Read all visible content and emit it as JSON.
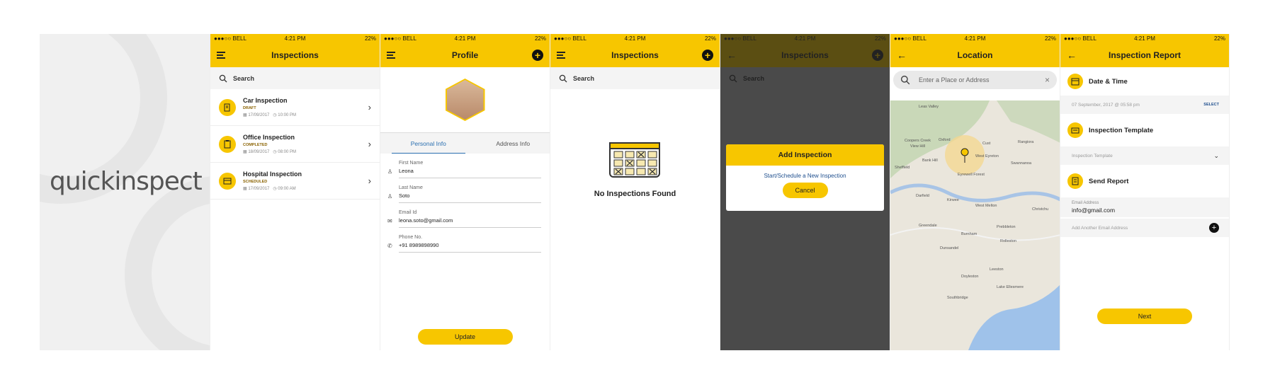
{
  "brand": {
    "logo_text_a": "quick",
    "logo_text_b": "inspect"
  },
  "status": {
    "carrier": "●●●○○ BELL",
    "time": "4:21 PM",
    "battery": "22%"
  },
  "screen1": {
    "title": "Inspections",
    "search_label": "Search",
    "items": [
      {
        "title": "Car Inspection",
        "status": "DRAFT",
        "date": "17/09/2017",
        "time": "10:00 PM"
      },
      {
        "title": "Office Inspection",
        "status": "COMPLETED",
        "date": "18/09/2017",
        "time": "08:00 PM"
      },
      {
        "title": "Hospital Inspection",
        "status": "SCHEDULED",
        "date": "17/09/2017",
        "time": "09:00 AM"
      }
    ]
  },
  "screen2": {
    "title": "Profile",
    "tabs": [
      "Personal Info",
      "Address Info"
    ],
    "fields": [
      {
        "label": "First Name",
        "value": "Leona"
      },
      {
        "label": "Last Name",
        "value": "Soto"
      },
      {
        "label": "Email Id",
        "value": "leona.soto@gmail.com"
      },
      {
        "label": "Phone No.",
        "value": "+91 8989898990"
      }
    ],
    "update_label": "Update"
  },
  "screen3": {
    "title": "Inspections",
    "search_label": "Search",
    "empty_text": "No Inspections Found"
  },
  "screen4": {
    "title": "Inspections",
    "search_label": "Search",
    "modal_title": "Add Inspection",
    "modal_action": "Start/Schedule a New Inspection",
    "cancel_label": "Cancel"
  },
  "screen5": {
    "title": "Location",
    "search_placeholder": "Enter a Place or Address",
    "map_labels": [
      "Leas Valley",
      "Coopers Creek",
      "View Hill",
      "Oxford",
      "Cust",
      "Rangiora",
      "West Eyreton",
      "Swannanoa",
      "Sheffield",
      "Darfield",
      "Kirwee",
      "West Melton",
      "Christchu",
      "Greendale",
      "Burnham",
      "Prebbleton",
      "Dunsandel",
      "Doyleston",
      "Leeston",
      "Lake Ellesmere",
      "Southbridge",
      "Rolleston",
      "Bank Hill",
      "Eyrewell Forest"
    ]
  },
  "screen6": {
    "title": "Inspection Report",
    "date_time_label": "Date & Time",
    "date_value": "07 September, 2017 @ 05:58 pm",
    "select_label": "SELECT",
    "template_label": "Inspection Template",
    "template_placeholder": "Inspection Template",
    "send_label": "Send Report",
    "email_label": "Email Address",
    "email_value": "info@gmail.com",
    "add_email_label": "Add Another Email Address",
    "next_label": "Next"
  },
  "colors": {
    "accent": "#f7c600",
    "dark_overlay": "#4a4a4a",
    "link": "#1f4f8e"
  }
}
